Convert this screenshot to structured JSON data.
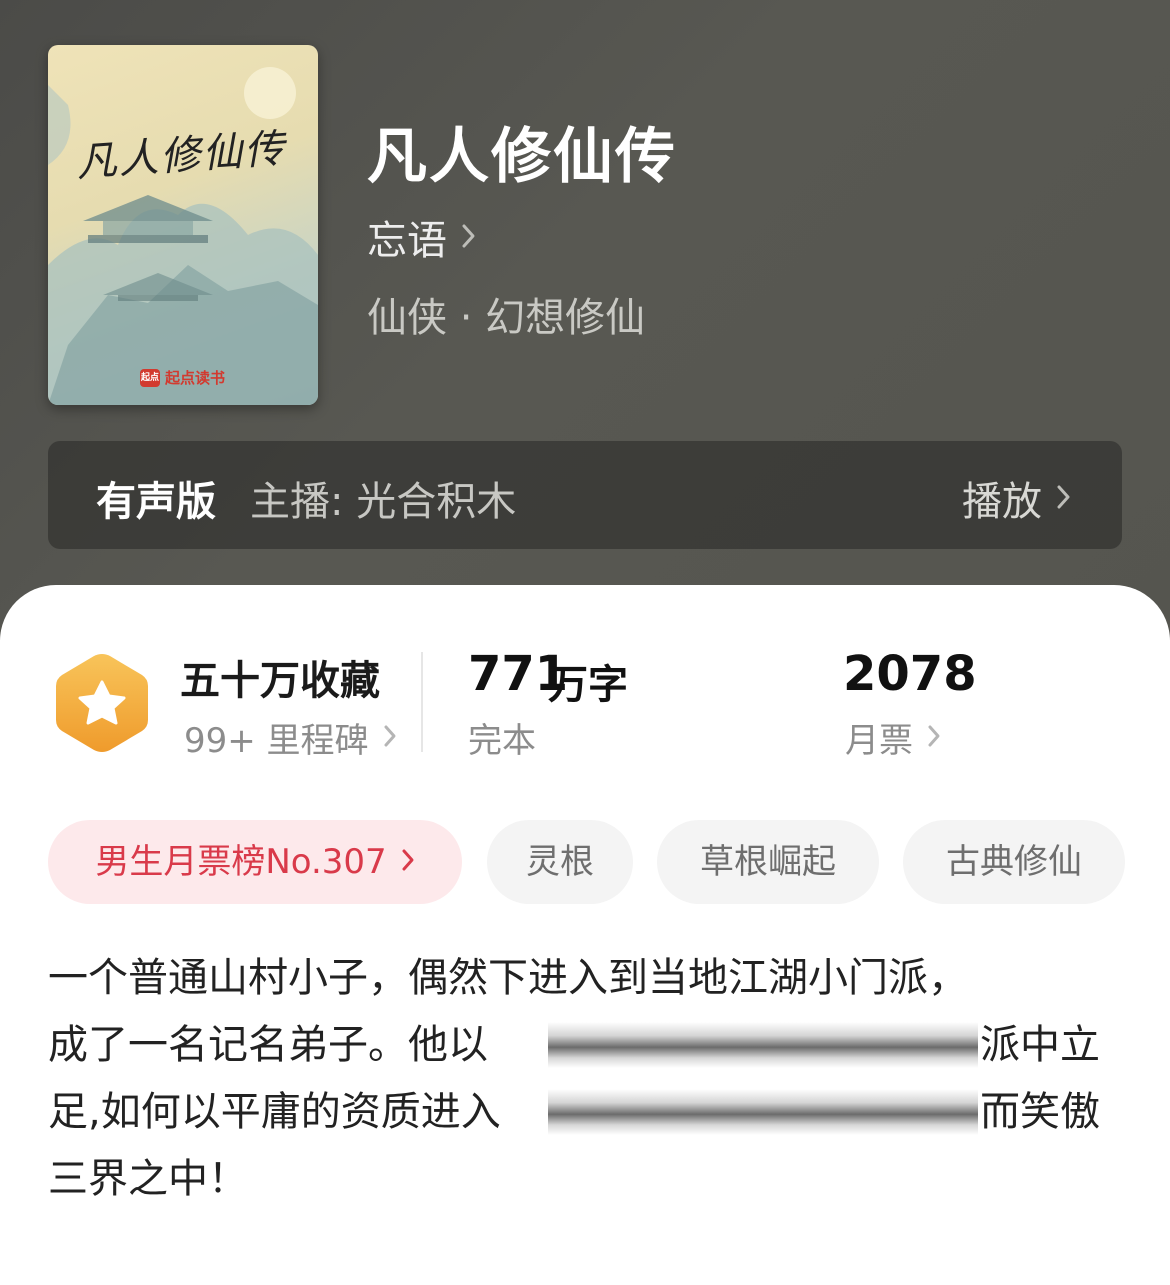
{
  "book": {
    "cover_title": "凡人修仙传",
    "cover_publisher": "起点读书",
    "cover_publisher_mark": "起点",
    "title": "凡人修仙传",
    "author": "忘语",
    "genre": "仙侠 · 幻想修仙"
  },
  "audio": {
    "label": "有声版",
    "host": "主播: 光合积木",
    "play": "播放"
  },
  "stats": {
    "collect": "五十万收藏",
    "milestone": "99+ 里程碑",
    "words_number": "771",
    "words_unit": "万字",
    "status": "完本",
    "tickets": "2078",
    "tickets_label": "月票"
  },
  "tags": {
    "rank": "男生月票榜No.307",
    "items": [
      "灵根",
      "草根崛起",
      "古典修仙"
    ]
  },
  "description": {
    "line1": "一个普通山村小子，偶然下进入到当地江湖小门派，",
    "line2a": "成了一名记名弟子。他以",
    "line2b": "派中立",
    "line3a": "足,如何以平庸的资质进入",
    "line3b": "而笑傲",
    "line4": "三界之中！"
  },
  "colors": {
    "rank_text": "#d93a4a",
    "rank_bg": "#fde9eb",
    "badge": "#f2a93b"
  }
}
